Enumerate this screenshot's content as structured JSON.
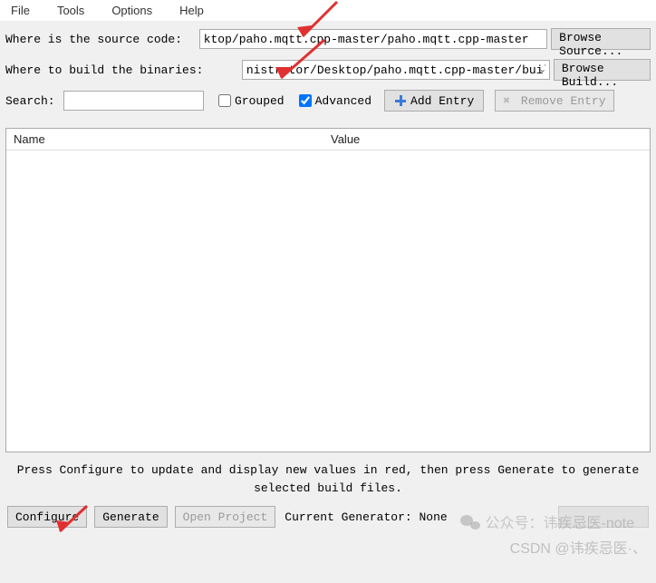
{
  "menu": {
    "file": "File",
    "tools": "Tools",
    "options": "Options",
    "help": "Help"
  },
  "labels": {
    "source": "Where is the source code:",
    "build": "Where to build the binaries:",
    "search": "Search:"
  },
  "inputs": {
    "source_value": "ktop/paho.mqtt.cpp-master/paho.mqtt.cpp-master",
    "build_value": "nistrator/Desktop/paho.mqtt.cpp-master/build",
    "search_value": ""
  },
  "buttons": {
    "browse_source": "Browse Source...",
    "browse_build": "Browse Build...",
    "add_entry": "Add Entry",
    "remove_entry": "Remove Entry",
    "configure": "Configure",
    "generate": "Generate",
    "open_project": "Open Project"
  },
  "checkboxes": {
    "grouped_label": "Grouped",
    "grouped_checked": false,
    "advanced_label": "Advanced",
    "advanced_checked": true
  },
  "table": {
    "col_name": "Name",
    "col_value": "Value"
  },
  "hint": {
    "line1": "Press Configure to update and display new values in red, then press Generate to generate",
    "line2": "selected build files."
  },
  "generator": {
    "label": "Current Generator: None"
  },
  "watermarks": {
    "w1": "公众号：讳疾忌医-note",
    "w2": "CSDN @讳疾忌医·、"
  }
}
